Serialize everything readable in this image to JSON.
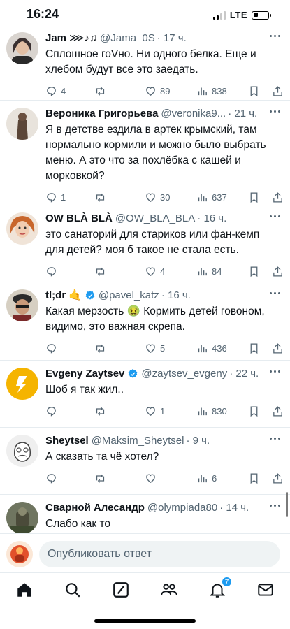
{
  "status_bar": {
    "time": "16:24",
    "network": "LTE"
  },
  "tweets": [
    {
      "name": "Jam",
      "name_suffix": "⋙♪♫",
      "handle": "@Jama_0S",
      "time": "· 17 ч.",
      "text": "Сплошное гоVно. Ни одного белка. Еще и хлебом будут все это заедать.",
      "replies": "4",
      "retweets": "",
      "likes": "89",
      "views": "838"
    },
    {
      "name": "Вероника Григорьева",
      "handle": "@veronika9...",
      "time": "· 21 ч.",
      "text": "Я в детстве ездила в артек крымский, там нормально кормили и можно было выбрать меню. А это что за похлёбка с кашей и морковкой?",
      "replies": "1",
      "retweets": "",
      "likes": "30",
      "views": "637"
    },
    {
      "name": "OW BLÀ BLÀ",
      "handle": "@OW_BLA_BLA",
      "time": "· 16 ч.",
      "text": "это санаторий для стариков или фан-кемп для детей? моя б такое не стала есть.",
      "replies": "",
      "retweets": "",
      "likes": "4",
      "views": "84"
    },
    {
      "name": "tl;dr",
      "name_suffix": "🤙",
      "handle": "@pavel_katz",
      "time": "· 16 ч.",
      "text": "Какая мерзость 🤢 Кормить детей говоном, видимо, это важная скрепа.",
      "replies": "",
      "retweets": "",
      "likes": "5",
      "views": "436"
    },
    {
      "name": "Evgeny Zaytsev",
      "handle": "@zaytsev_evgeny",
      "time": "· 22 ч.",
      "text": "Шоб я так жил..",
      "replies": "",
      "retweets": "",
      "likes": "1",
      "views": "830"
    },
    {
      "name": "Sheytsel",
      "handle": "@Maksim_Sheytsel",
      "time": "· 9 ч.",
      "text": "А сказать та чё хотел?",
      "replies": "",
      "retweets": "",
      "likes": "",
      "views": "6"
    },
    {
      "name": "Сварной Алесандр",
      "handle": "@olympiada80",
      "time": "· 14 ч.",
      "text": "Слабо как то",
      "replies": "",
      "retweets": "",
      "likes": "",
      "views": ""
    }
  ],
  "reply_bar": {
    "placeholder": "Опубликовать ответ"
  },
  "bottom_nav": {
    "notifications_badge": "7"
  },
  "colors": {
    "accent": "#1d9bf0",
    "text": "#0f1419",
    "secondary": "#536471"
  }
}
